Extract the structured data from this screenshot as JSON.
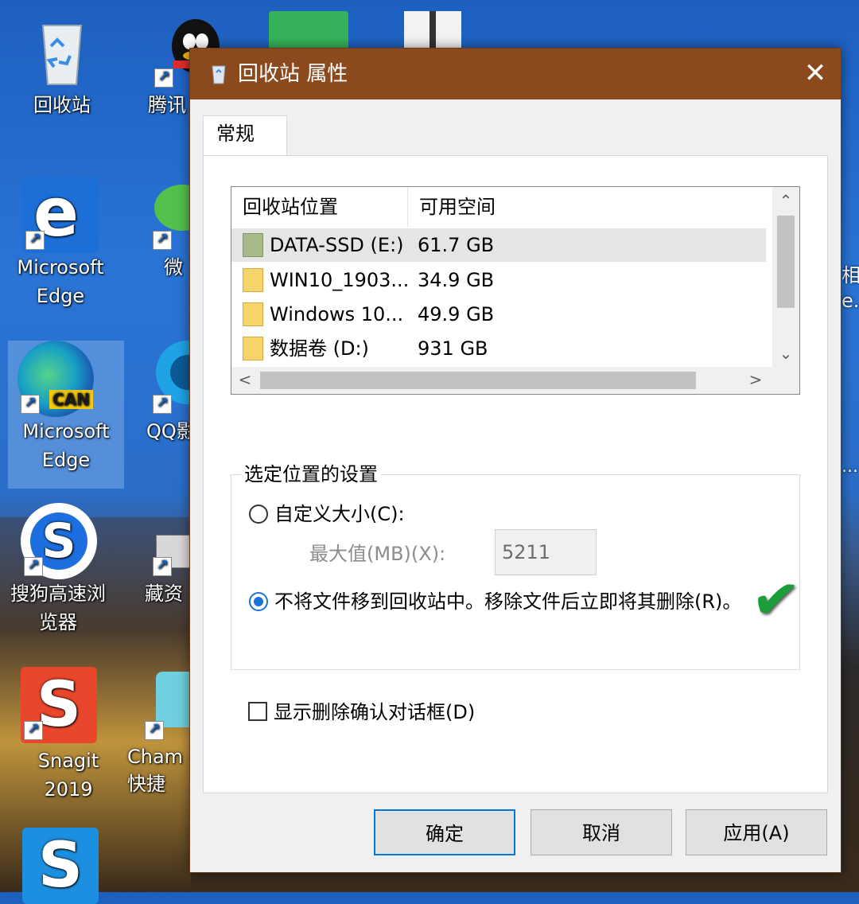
{
  "desktop": {
    "icons": [
      {
        "label": "回收站"
      },
      {
        "label": "腾讯"
      },
      {
        "label": "Microsoft Edge"
      },
      {
        "label": "微"
      },
      {
        "label": "Microsoft Edge"
      },
      {
        "label": "QQ影"
      },
      {
        "label": "搜狗高速浏览器"
      },
      {
        "label": "藏资"
      },
      {
        "label": "Snagit 2019"
      },
      {
        "label": "Cham - 快捷"
      }
    ],
    "edge_badge": "CAN",
    "right_partial": {
      "line1": "相",
      "line2": "e...",
      "line3": "..."
    }
  },
  "dialog": {
    "title": "回收站 属性",
    "close_glyph": "✕",
    "tab": "常规",
    "list": {
      "headers": [
        "回收站位置",
        "可用空间"
      ],
      "rows": [
        {
          "name": "DATA-SSD (E:)",
          "space": "61.7 GB",
          "selected": true
        },
        {
          "name": "WIN10_1903...",
          "space": "34.9 GB"
        },
        {
          "name": "Windows 10...",
          "space": "49.9 GB"
        },
        {
          "name": "数据卷 (D:)",
          "space": "931 GB"
        }
      ],
      "scroll_up": "⌃",
      "scroll_down": "⌄",
      "scroll_left": "<",
      "scroll_right": ">"
    },
    "settings": {
      "legend": "选定位置的设置",
      "custom_size_label": "自定义大小(C):",
      "max_label": "最大值(MB)(X):",
      "max_value": "5211",
      "no_recycle_label": "不将文件移到回收站中。移除文件后立即将其删除(R)。",
      "selected_option": "no_recycle",
      "checkmark": "✔"
    },
    "confirm_checkbox": {
      "label": "显示删除确认对话框(D)",
      "checked": false
    },
    "buttons": {
      "ok": "确定",
      "cancel": "取消",
      "apply": "应用(A)"
    }
  }
}
